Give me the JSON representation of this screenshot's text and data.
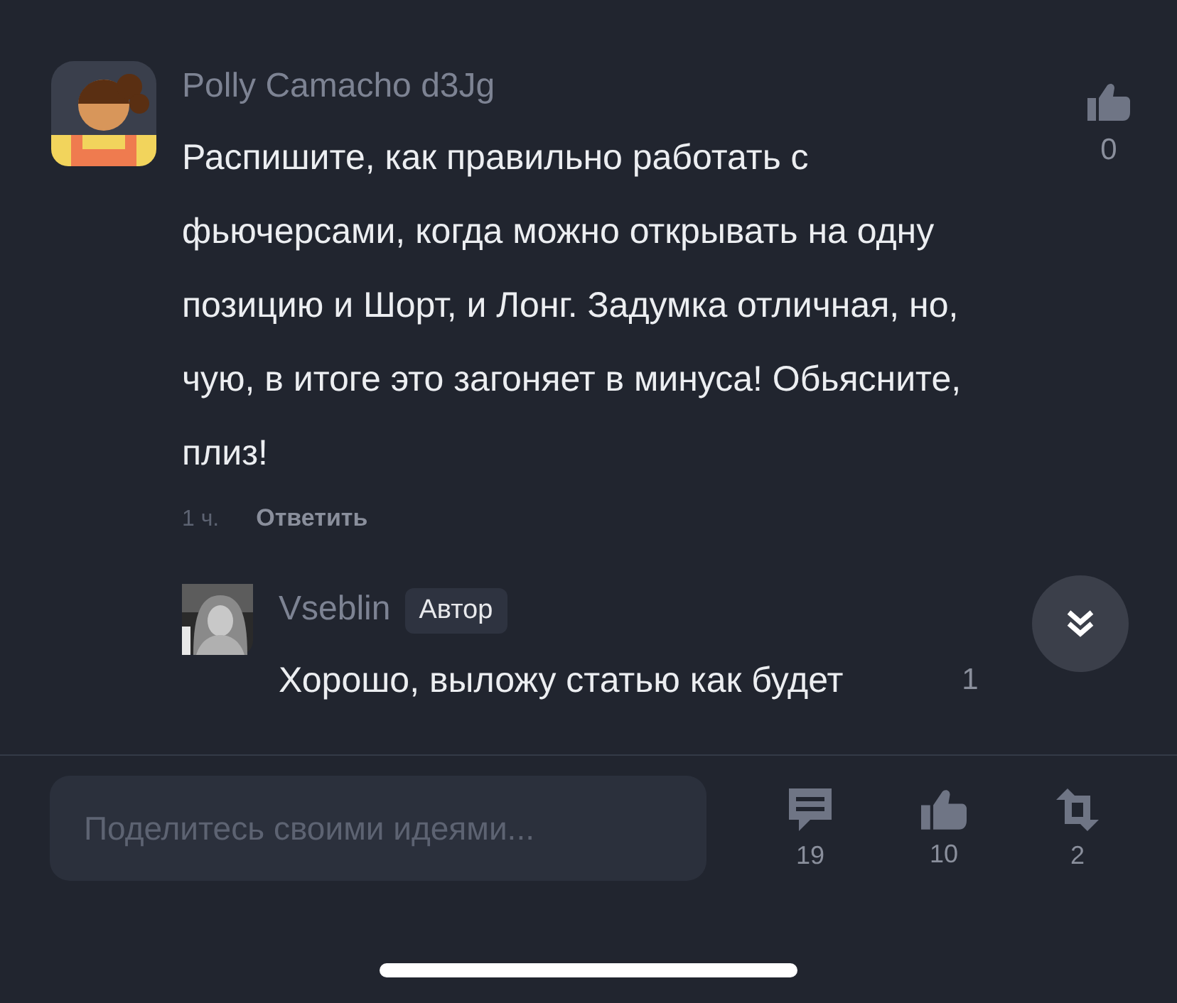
{
  "comments": [
    {
      "author": "Polly Camacho d3Jg",
      "text": "Распишите, как правильно работать с фьючерсами, когда можно открывать на одну позицию и Шорт, и Лонг. Задумка отличная, но, чую, в итоге это загоняет в минуса! Обьясните, плиз!",
      "likes": "0",
      "time": "1 ч.",
      "reply_label": "Ответить",
      "replies": [
        {
          "author": "Vseblin",
          "badge": "Автор",
          "text": "Хорошо, выложу статью как будет",
          "likes": "1"
        }
      ]
    }
  ],
  "composer": {
    "placeholder": "Поделитесь своими идеями..."
  },
  "actions": [
    {
      "kind": "comments",
      "count": "19"
    },
    {
      "kind": "likes",
      "count": "10"
    },
    {
      "kind": "reposts",
      "count": "2"
    }
  ]
}
